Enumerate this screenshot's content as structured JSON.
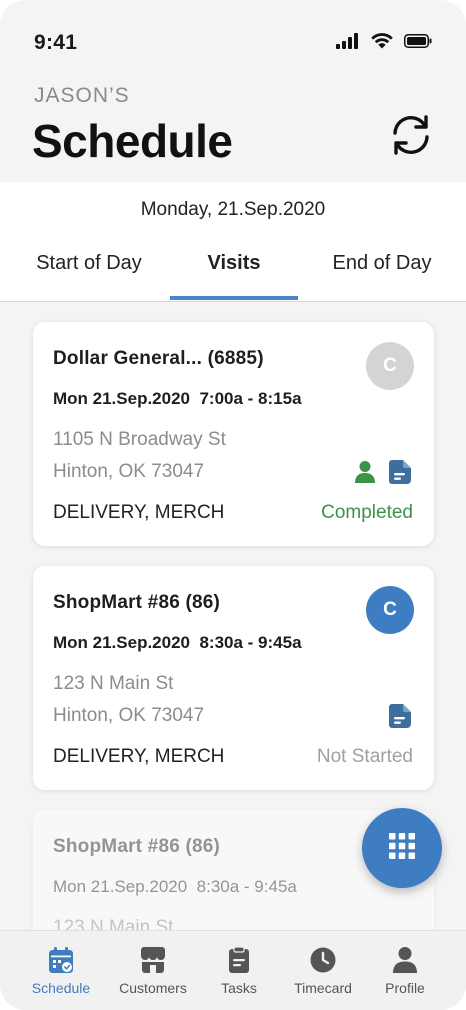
{
  "status_bar": {
    "time": "9:41"
  },
  "header": {
    "owner": "JASON’S",
    "title": "Schedule"
  },
  "date": "Monday, 21.Sep.2020",
  "tabs": [
    {
      "label": "Start of Day",
      "active": false
    },
    {
      "label": "Visits",
      "active": true
    },
    {
      "label": "End of Day",
      "active": false
    }
  ],
  "visits": [
    {
      "store": "Dollar General... (6885)",
      "when": "Mon 21.Sep.2020  7:00a - 8:15a",
      "address_line1": "1105 N Broadway St",
      "address_line2": "Hinton, OK 73047",
      "types": "DELIVERY, MERCH",
      "status": "Completed",
      "badge": "C",
      "badge_color": "#d4d4d4",
      "status_color": "#3a9447",
      "icons": [
        "person-icon",
        "document-icon"
      ]
    },
    {
      "store": "ShopMart #86 (86)",
      "when": "Mon 21.Sep.2020  8:30a - 9:45a",
      "address_line1": "123 N Main St",
      "address_line2": "Hinton, OK 73047",
      "types": "DELIVERY, MERCH",
      "status": "Not Started",
      "badge": "C",
      "badge_color": "#3e7dc1",
      "status_color": "#a0a0a0",
      "icons": [
        "document-icon"
      ]
    },
    {
      "store": "ShopMart #86 (86)",
      "when": "Mon 21.Sep.2020  8:30a - 9:45a",
      "address_line1": "123 N Main St"
    }
  ],
  "bottom_nav": [
    {
      "label": "Schedule",
      "icon": "calendar-icon",
      "active": true
    },
    {
      "label": "Customers",
      "icon": "store-icon",
      "active": false
    },
    {
      "label": "Tasks",
      "icon": "clipboard-icon",
      "active": false
    },
    {
      "label": "Timecard",
      "icon": "clock-icon",
      "active": false
    },
    {
      "label": "Profile",
      "icon": "person-icon",
      "active": false
    }
  ],
  "colors": {
    "accent": "#3e7dc1",
    "completed": "#3a9447",
    "muted": "#8c8c8c"
  }
}
